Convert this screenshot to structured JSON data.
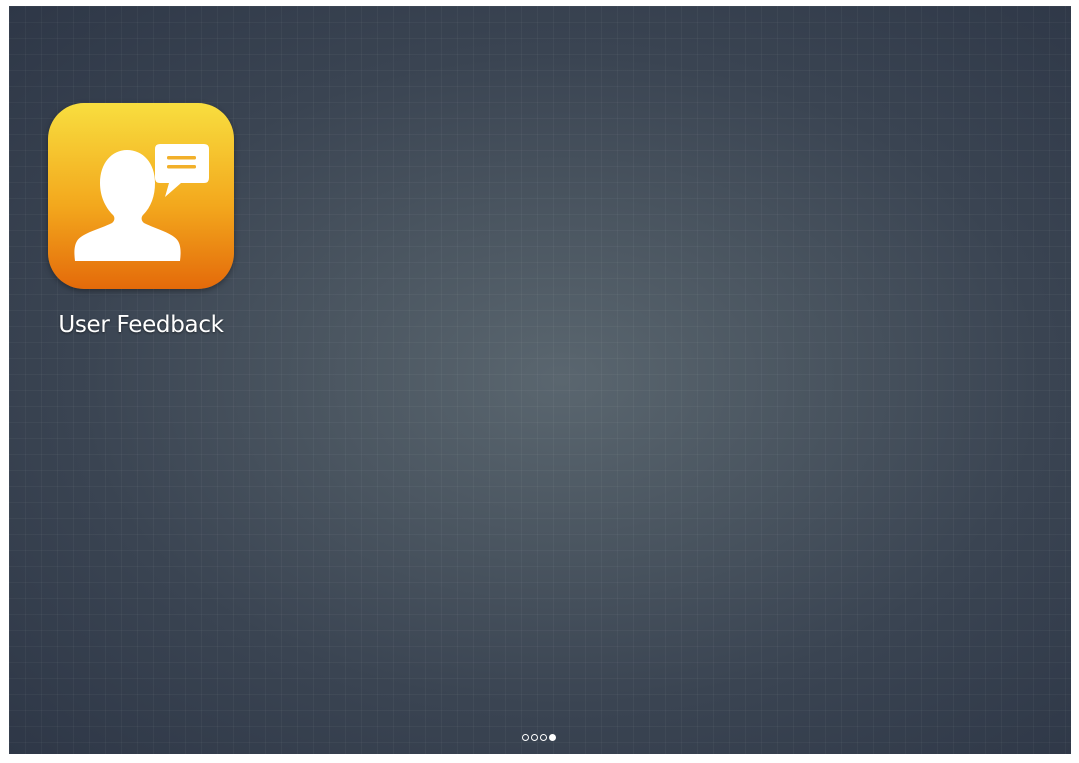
{
  "home_screen": {
    "apps": [
      {
        "label": "User Feedback",
        "icon": "user-feedback-icon",
        "icon_gradient": [
          "#f8de3f",
          "#f3a81d",
          "#e46a0a"
        ]
      }
    ]
  },
  "page_indicator": {
    "total_pages": 4,
    "current_page": 4
  }
}
